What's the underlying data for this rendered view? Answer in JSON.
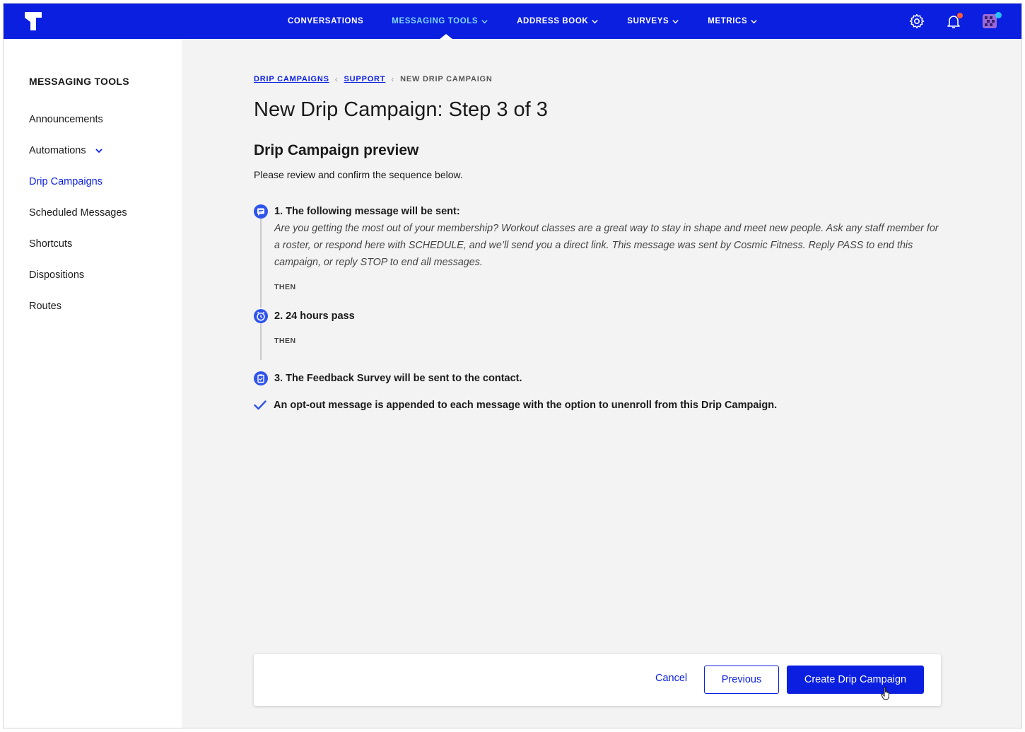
{
  "colors": {
    "brand": "#0a1fe0",
    "nav_active": "#7fd8ff",
    "notification_dot": "#ff5a36",
    "avatar_dot": "#28c3ff"
  },
  "nav": {
    "items": [
      {
        "label": "CONVERSATIONS",
        "dropdown": false,
        "active": false
      },
      {
        "label": "MESSAGING TOOLS",
        "dropdown": true,
        "active": true
      },
      {
        "label": "ADDRESS BOOK",
        "dropdown": true,
        "active": false
      },
      {
        "label": "SURVEYS",
        "dropdown": true,
        "active": false
      },
      {
        "label": "METRICS",
        "dropdown": true,
        "active": false
      }
    ],
    "icons": [
      "gear-icon",
      "bell-icon",
      "avatar-icon"
    ]
  },
  "sidebar": {
    "title": "MESSAGING TOOLS",
    "items": [
      {
        "label": "Announcements"
      },
      {
        "label": "Automations",
        "dropdown": true
      },
      {
        "label": "Drip Campaigns",
        "active": true
      },
      {
        "label": "Scheduled Messages"
      },
      {
        "label": "Shortcuts"
      },
      {
        "label": "Dispositions"
      },
      {
        "label": "Routes"
      }
    ]
  },
  "breadcrumb": {
    "links": [
      "DRIP CAMPAIGNS",
      "SUPPORT"
    ],
    "current": "NEW DRIP CAMPAIGN"
  },
  "page": {
    "title": "New Drip Campaign: Step 3 of 3",
    "section_title": "Drip Campaign preview",
    "section_desc": "Please review and confirm the sequence below."
  },
  "steps": [
    {
      "icon": "message-icon",
      "title": "1. The following message will be sent:",
      "message": "Are you getting the most out of your membership? Workout classes are a great way to stay in shape and meet new people. Ask any staff member for a roster, or respond here with SCHEDULE, and we’ll send you a direct link. This message was sent by Cosmic Fitness. Reply PASS to end this campaign, or reply STOP to end all messages.",
      "connector": "THEN"
    },
    {
      "icon": "clock-icon",
      "title": "2. 24 hours pass",
      "connector": "THEN"
    },
    {
      "icon": "clipboard-icon",
      "title": "3. The Feedback Survey will be sent to the contact."
    }
  ],
  "optout": {
    "icon": "checkmark-icon",
    "text": "An opt-out message is appended to each message with the option to unenroll from this Drip Campaign."
  },
  "footer": {
    "cancel_label": "Cancel",
    "previous_label": "Previous",
    "create_label": "Create Drip Campaign"
  }
}
